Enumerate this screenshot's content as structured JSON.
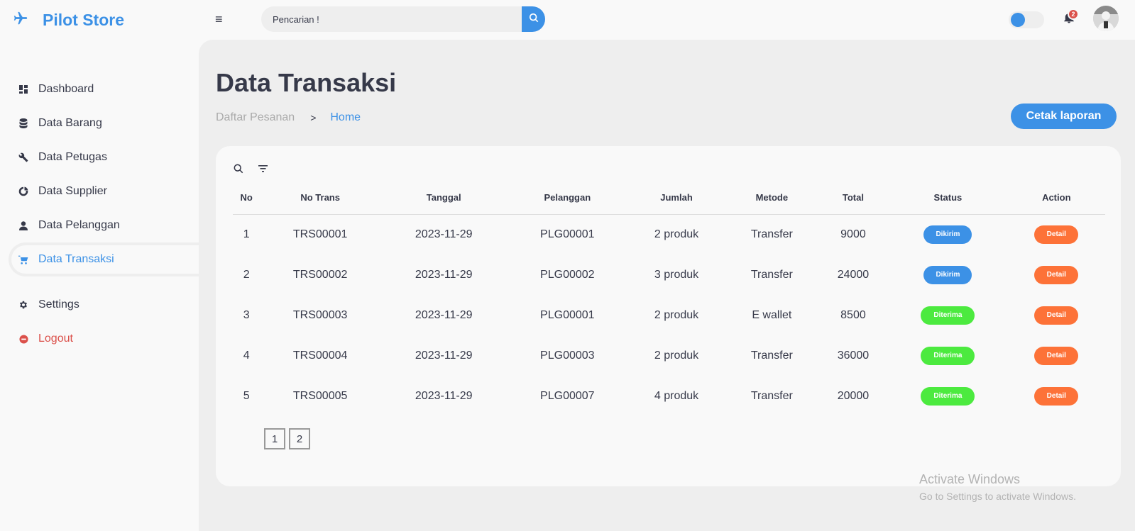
{
  "brand": {
    "name": "Pilot Store"
  },
  "header": {
    "search_placeholder": "Pencarian !",
    "notification_count": "2"
  },
  "sidebar": {
    "items": [
      {
        "label": "Dashboard",
        "icon": "dashboard-icon"
      },
      {
        "label": "Data Barang",
        "icon": "database-icon"
      },
      {
        "label": "Data Petugas",
        "icon": "wrench-icon"
      },
      {
        "label": "Data Supplier",
        "icon": "pie-chart-icon"
      },
      {
        "label": "Data Pelanggan",
        "icon": "user-icon"
      },
      {
        "label": "Data Transaksi",
        "icon": "cart-icon",
        "active": true
      }
    ],
    "bottom": [
      {
        "label": "Settings",
        "icon": "gear-icon"
      },
      {
        "label": "Logout",
        "icon": "logout-icon"
      }
    ]
  },
  "main": {
    "title": "Data Transaksi",
    "breadcrumb": [
      "Daftar Pesanan",
      ">",
      "Home"
    ],
    "report_button": "Cetak laporan",
    "table": {
      "headers": [
        "No",
        "No Trans",
        "Tanggal",
        "Pelanggan",
        "Jumlah",
        "Metode",
        "Total",
        "Status",
        "Action"
      ],
      "rows": [
        {
          "no": "1",
          "trans": "TRS00001",
          "date": "2023-11-29",
          "customer": "PLG00001",
          "qty": "2 produk",
          "method": "Transfer",
          "total": "9000",
          "status": "Dikirim",
          "action": "Detail"
        },
        {
          "no": "2",
          "trans": "TRS00002",
          "date": "2023-11-29",
          "customer": "PLG00002",
          "qty": "3 produk",
          "method": "Transfer",
          "total": "24000",
          "status": "Dikirim",
          "action": "Detail"
        },
        {
          "no": "3",
          "trans": "TRS00003",
          "date": "2023-11-29",
          "customer": "PLG00001",
          "qty": "2 produk",
          "method": "E wallet",
          "total": "8500",
          "status": "Diterima",
          "action": "Detail"
        },
        {
          "no": "4",
          "trans": "TRS00004",
          "date": "2023-11-29",
          "customer": "PLG00003",
          "qty": "2 produk",
          "method": "Transfer",
          "total": "36000",
          "status": "Diterima",
          "action": "Detail"
        },
        {
          "no": "5",
          "trans": "TRS00005",
          "date": "2023-11-29",
          "customer": "PLG00007",
          "qty": "4 produk",
          "method": "Transfer",
          "total": "20000",
          "status": "Diterima",
          "action": "Detail"
        }
      ]
    },
    "pagination": [
      "1",
      "2"
    ]
  },
  "watermark": {
    "line1": "Activate Windows",
    "line2": "Go to Settings to activate Windows."
  },
  "colors": {
    "accent": "#3c91e6",
    "dikirim": "#3c91e6",
    "diterima": "#4cea3f",
    "detail": "#fd7238",
    "danger": "#db504a"
  }
}
